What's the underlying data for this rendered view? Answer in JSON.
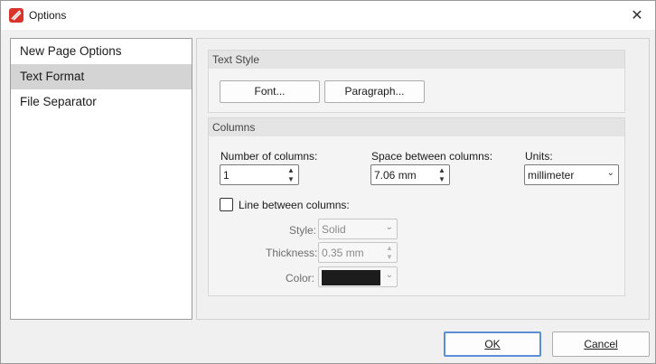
{
  "window": {
    "title": "Options",
    "close_glyph": "✕"
  },
  "nav": {
    "items": [
      {
        "label": "New Page Options",
        "selected": false
      },
      {
        "label": "Text Format",
        "selected": true
      },
      {
        "label": "File Separator",
        "selected": false
      }
    ]
  },
  "text_style": {
    "header": "Text Style",
    "font_button": "Font...",
    "paragraph_button": "Paragraph..."
  },
  "columns": {
    "header": "Columns",
    "number_label": "Number of columns:",
    "number_value": "1",
    "space_label": "Space between columns:",
    "space_value": "7.06 mm",
    "units_label": "Units:",
    "units_value": "millimeter",
    "line_between_label": "Line between columns:",
    "line_between_checked": false,
    "style_label": "Style:",
    "style_value": "Solid",
    "thickness_label": "Thickness:",
    "thickness_value": "0.35 mm",
    "color_label": "Color:",
    "color_value": "#1c1c1c"
  },
  "footer": {
    "ok_label": "OK",
    "cancel_label": "Cancel"
  },
  "colors": {
    "accent_focus": "#5a8fd8",
    "app_icon": "#d9342b",
    "selected_row": "#d4d4d4"
  },
  "icons": {
    "app": "app-logo-icon",
    "close": "close-icon",
    "spin_up": "spin-up-icon",
    "spin_down": "spin-down-icon",
    "dropdown": "chevron-down-icon"
  }
}
